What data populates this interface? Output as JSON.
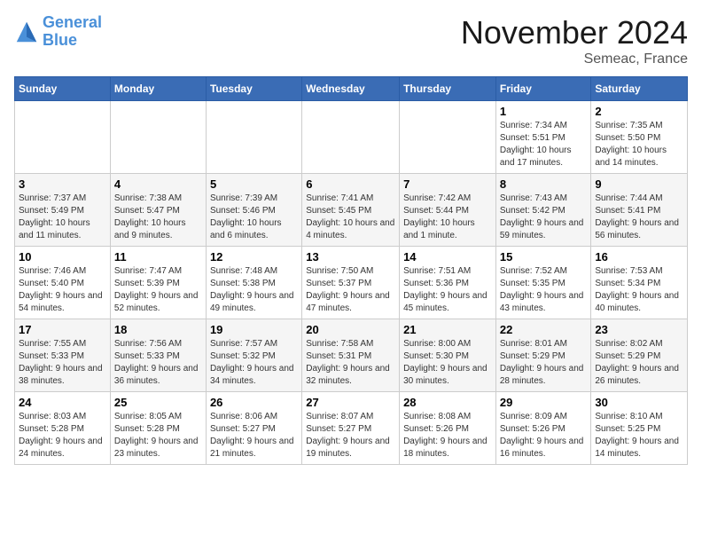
{
  "header": {
    "logo_line1": "General",
    "logo_line2": "Blue",
    "month": "November 2024",
    "location": "Semeac, France"
  },
  "weekdays": [
    "Sunday",
    "Monday",
    "Tuesday",
    "Wednesday",
    "Thursday",
    "Friday",
    "Saturday"
  ],
  "weeks": [
    [
      {
        "day": "",
        "info": ""
      },
      {
        "day": "",
        "info": ""
      },
      {
        "day": "",
        "info": ""
      },
      {
        "day": "",
        "info": ""
      },
      {
        "day": "",
        "info": ""
      },
      {
        "day": "1",
        "info": "Sunrise: 7:34 AM\nSunset: 5:51 PM\nDaylight: 10 hours and 17 minutes."
      },
      {
        "day": "2",
        "info": "Sunrise: 7:35 AM\nSunset: 5:50 PM\nDaylight: 10 hours and 14 minutes."
      }
    ],
    [
      {
        "day": "3",
        "info": "Sunrise: 7:37 AM\nSunset: 5:49 PM\nDaylight: 10 hours and 11 minutes."
      },
      {
        "day": "4",
        "info": "Sunrise: 7:38 AM\nSunset: 5:47 PM\nDaylight: 10 hours and 9 minutes."
      },
      {
        "day": "5",
        "info": "Sunrise: 7:39 AM\nSunset: 5:46 PM\nDaylight: 10 hours and 6 minutes."
      },
      {
        "day": "6",
        "info": "Sunrise: 7:41 AM\nSunset: 5:45 PM\nDaylight: 10 hours and 4 minutes."
      },
      {
        "day": "7",
        "info": "Sunrise: 7:42 AM\nSunset: 5:44 PM\nDaylight: 10 hours and 1 minute."
      },
      {
        "day": "8",
        "info": "Sunrise: 7:43 AM\nSunset: 5:42 PM\nDaylight: 9 hours and 59 minutes."
      },
      {
        "day": "9",
        "info": "Sunrise: 7:44 AM\nSunset: 5:41 PM\nDaylight: 9 hours and 56 minutes."
      }
    ],
    [
      {
        "day": "10",
        "info": "Sunrise: 7:46 AM\nSunset: 5:40 PM\nDaylight: 9 hours and 54 minutes."
      },
      {
        "day": "11",
        "info": "Sunrise: 7:47 AM\nSunset: 5:39 PM\nDaylight: 9 hours and 52 minutes."
      },
      {
        "day": "12",
        "info": "Sunrise: 7:48 AM\nSunset: 5:38 PM\nDaylight: 9 hours and 49 minutes."
      },
      {
        "day": "13",
        "info": "Sunrise: 7:50 AM\nSunset: 5:37 PM\nDaylight: 9 hours and 47 minutes."
      },
      {
        "day": "14",
        "info": "Sunrise: 7:51 AM\nSunset: 5:36 PM\nDaylight: 9 hours and 45 minutes."
      },
      {
        "day": "15",
        "info": "Sunrise: 7:52 AM\nSunset: 5:35 PM\nDaylight: 9 hours and 43 minutes."
      },
      {
        "day": "16",
        "info": "Sunrise: 7:53 AM\nSunset: 5:34 PM\nDaylight: 9 hours and 40 minutes."
      }
    ],
    [
      {
        "day": "17",
        "info": "Sunrise: 7:55 AM\nSunset: 5:33 PM\nDaylight: 9 hours and 38 minutes."
      },
      {
        "day": "18",
        "info": "Sunrise: 7:56 AM\nSunset: 5:33 PM\nDaylight: 9 hours and 36 minutes."
      },
      {
        "day": "19",
        "info": "Sunrise: 7:57 AM\nSunset: 5:32 PM\nDaylight: 9 hours and 34 minutes."
      },
      {
        "day": "20",
        "info": "Sunrise: 7:58 AM\nSunset: 5:31 PM\nDaylight: 9 hours and 32 minutes."
      },
      {
        "day": "21",
        "info": "Sunrise: 8:00 AM\nSunset: 5:30 PM\nDaylight: 9 hours and 30 minutes."
      },
      {
        "day": "22",
        "info": "Sunrise: 8:01 AM\nSunset: 5:29 PM\nDaylight: 9 hours and 28 minutes."
      },
      {
        "day": "23",
        "info": "Sunrise: 8:02 AM\nSunset: 5:29 PM\nDaylight: 9 hours and 26 minutes."
      }
    ],
    [
      {
        "day": "24",
        "info": "Sunrise: 8:03 AM\nSunset: 5:28 PM\nDaylight: 9 hours and 24 minutes."
      },
      {
        "day": "25",
        "info": "Sunrise: 8:05 AM\nSunset: 5:28 PM\nDaylight: 9 hours and 23 minutes."
      },
      {
        "day": "26",
        "info": "Sunrise: 8:06 AM\nSunset: 5:27 PM\nDaylight: 9 hours and 21 minutes."
      },
      {
        "day": "27",
        "info": "Sunrise: 8:07 AM\nSunset: 5:27 PM\nDaylight: 9 hours and 19 minutes."
      },
      {
        "day": "28",
        "info": "Sunrise: 8:08 AM\nSunset: 5:26 PM\nDaylight: 9 hours and 18 minutes."
      },
      {
        "day": "29",
        "info": "Sunrise: 8:09 AM\nSunset: 5:26 PM\nDaylight: 9 hours and 16 minutes."
      },
      {
        "day": "30",
        "info": "Sunrise: 8:10 AM\nSunset: 5:25 PM\nDaylight: 9 hours and 14 minutes."
      }
    ]
  ]
}
